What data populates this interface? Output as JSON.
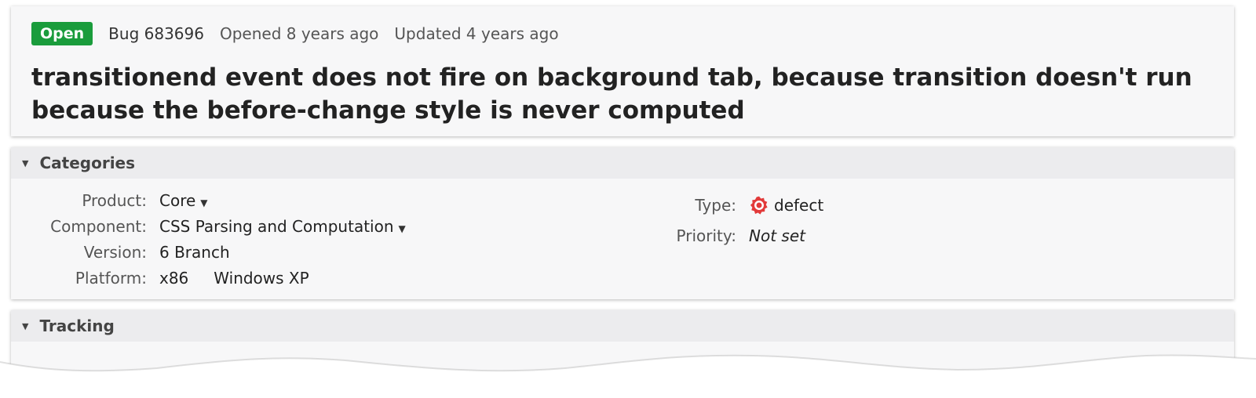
{
  "header": {
    "status": "Open",
    "bug_id": "Bug 683696",
    "opened": "Opened 8 years ago",
    "updated": "Updated 4 years ago",
    "title": "transitionend event does not fire on background tab, because transition doesn't run because the before-change style is never computed"
  },
  "categories": {
    "heading": "Categories",
    "product": {
      "label": "Product:",
      "value": "Core"
    },
    "component": {
      "label": "Component:",
      "value": "CSS Parsing and Computation"
    },
    "version": {
      "label": "Version:",
      "value": "6 Branch"
    },
    "platform": {
      "label": "Platform:",
      "arch": "x86",
      "os": "Windows XP"
    },
    "type": {
      "label": "Type:",
      "value": "defect",
      "icon": "defect-icon"
    },
    "priority": {
      "label": "Priority:",
      "value": "Not set"
    }
  },
  "tracking": {
    "heading": "Tracking"
  },
  "colors": {
    "status_open": "#1a9c3c",
    "defect": "#e23a3a"
  }
}
